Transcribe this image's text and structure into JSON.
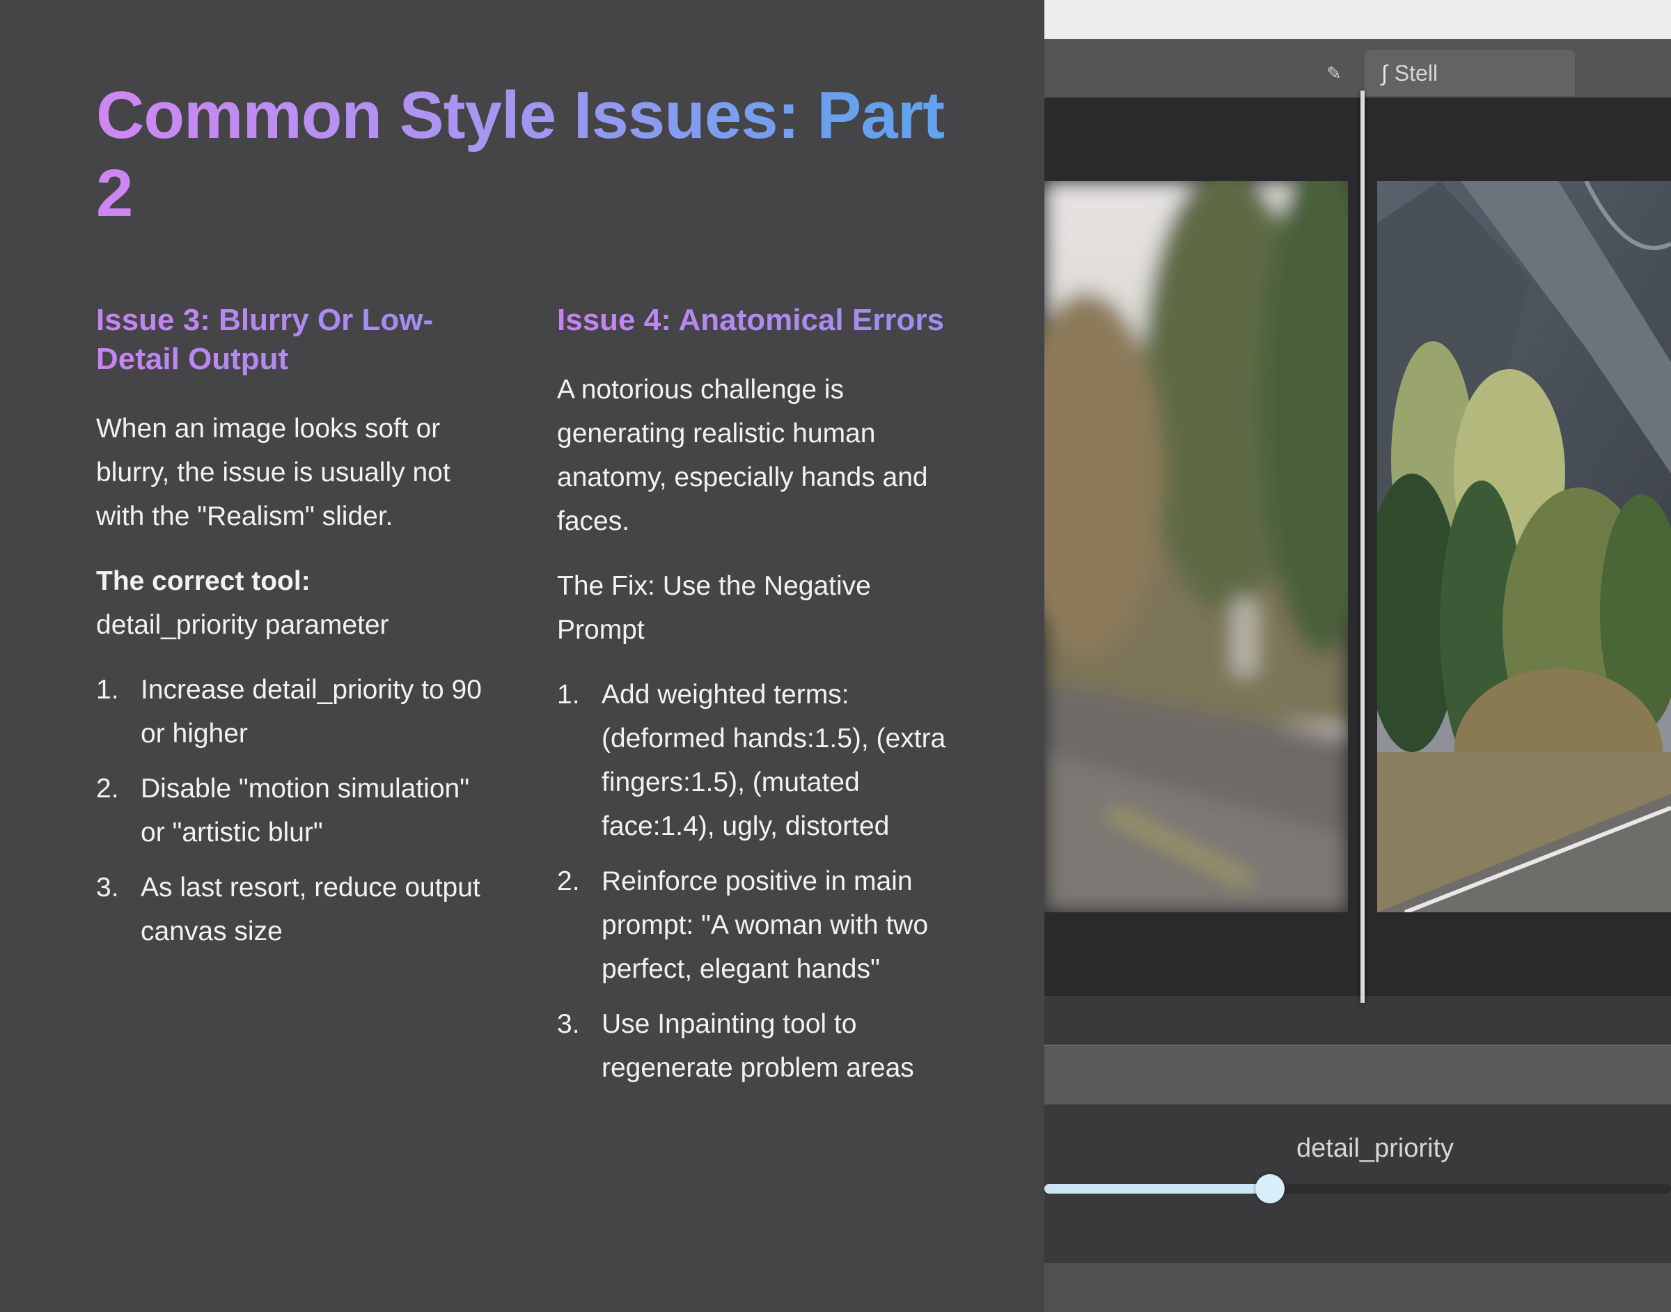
{
  "title": "Common Style Issues: Part 2",
  "issue3": {
    "heading": "Issue 3: Blurry Or Low-Detail Output",
    "intro": "When an image looks soft or blurry, the issue is usually not with the \"Realism\" slider.",
    "tool_label": "The correct tool:",
    "tool_value": "detail_priority parameter",
    "steps": [
      {
        "num": "1.",
        "text": "Increase detail_priority to 90 or higher"
      },
      {
        "num": "2.",
        "text": "Disable \"motion simulation\" or \"artistic blur\""
      },
      {
        "num": "3.",
        "text": "As last resort, reduce output canvas size"
      }
    ]
  },
  "issue4": {
    "heading": "Issue 4: Anatomical Errors",
    "intro": "A notorious challenge is generating realistic human anatomy, especially hands and faces.",
    "fix_label": "The Fix: Use the Negative Prompt",
    "steps": [
      {
        "num": "1.",
        "text": "Add weighted terms: (deformed hands:1.5), (extra fingers:1.5), (mutated face:1.4), ugly, distorted"
      },
      {
        "num": "2.",
        "text": "Reinforce positive in main prompt: \"A woman with two perfect, elegant hands\""
      },
      {
        "num": "3.",
        "text": "Use Inpainting tool to regenerate problem areas"
      }
    ]
  },
  "screenshot": {
    "tab_label": "Stell",
    "tab_icon": "brush-icon",
    "slider_label": "detail_priority",
    "slider_level_percent": 36
  },
  "colors": {
    "background": "#454446",
    "title_gradient_start": "#cf86f2",
    "title_gradient_end": "#62a2ee",
    "heading_color": "#c684f1",
    "body_text": "#f2f2f2",
    "slider_fill": "#cde6f5"
  }
}
